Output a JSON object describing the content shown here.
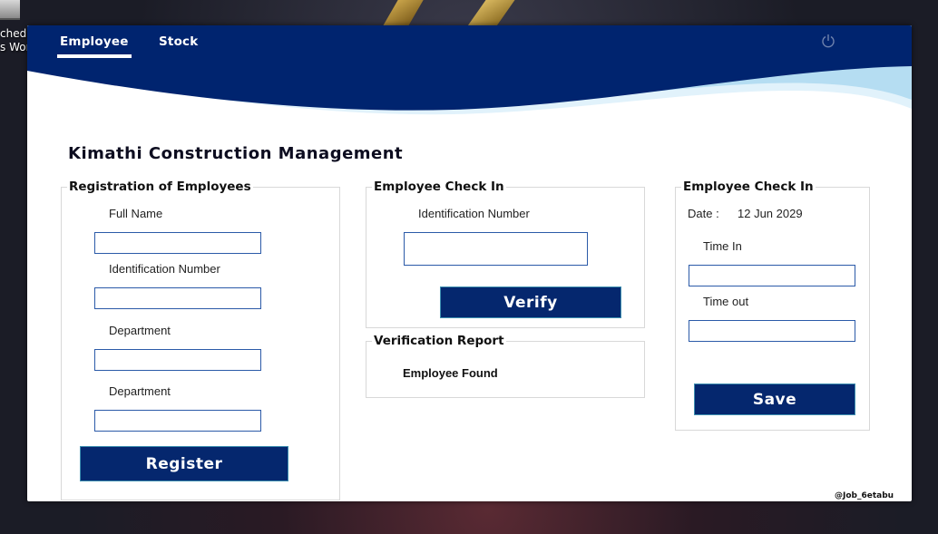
{
  "desktop": {
    "icon_label": "ched\ns Worl"
  },
  "tabs": [
    {
      "label": "Employee",
      "active": true
    },
    {
      "label": "Stock",
      "active": false
    }
  ],
  "header": {
    "power_icon": "power-icon",
    "brand_color": "#00246f"
  },
  "app_title": "Kimathi Construction Management",
  "registration": {
    "legend": "Registration of Employees",
    "full_name_label": "Full Name",
    "full_name_value": "",
    "id_label": "Identification Number",
    "id_value": "",
    "department_label": "Department",
    "department_value": "",
    "department2_label": "Department",
    "department2_value": "",
    "register_label": "Register"
  },
  "check_in": {
    "legend": "Employee Check In",
    "id_label": "Identification Number",
    "id_value": "",
    "verify_label": "Verify"
  },
  "report": {
    "legend": "Verification Report",
    "message": "Employee Found"
  },
  "check_in_time": {
    "legend": "Employee Check In",
    "date_label": "Date :",
    "date_value": "12 Jun 2029",
    "time_in_label": "Time In",
    "time_in_value": "",
    "time_out_label": "Time out",
    "time_out_value": "",
    "save_label": "Save"
  },
  "footer": {
    "credit": "@Job_6etabu"
  }
}
